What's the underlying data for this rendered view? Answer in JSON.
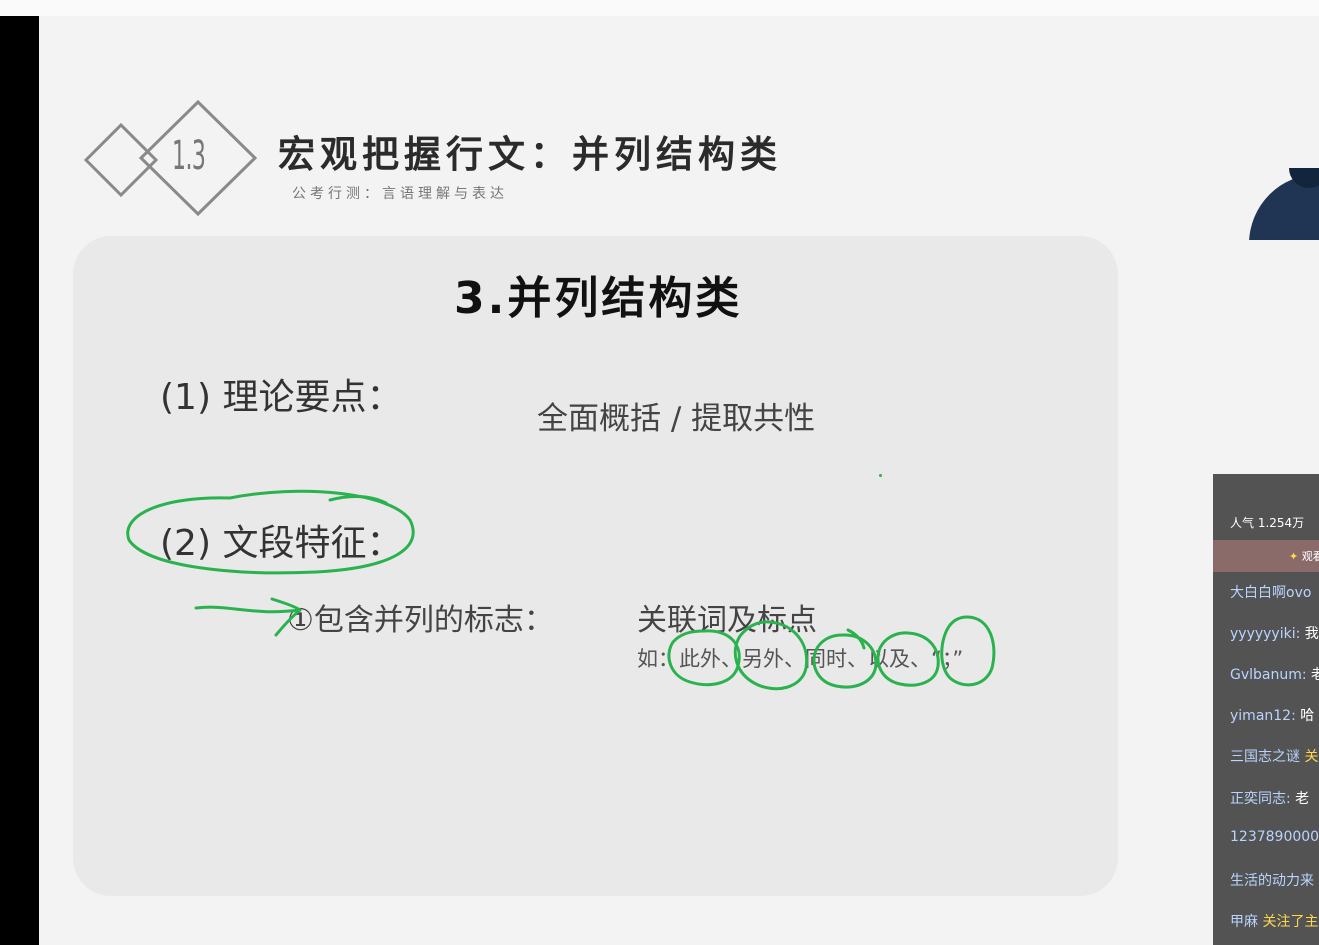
{
  "header": {
    "badge_number": "1.3",
    "title": "宏观把握行文：并列结构类",
    "subtitle": "公考行测：言语理解与表达"
  },
  "card": {
    "title": "3.并列结构类",
    "item1": {
      "label": "(1) 理论要点：",
      "value": "全面概括 / 提取共性"
    },
    "item2": {
      "label": "(2) 文段特征："
    },
    "sub1": {
      "label": "①包含并列的标志：",
      "value": "关联词及标点"
    },
    "examples": {
      "prefix": "如：",
      "items": [
        "此外",
        "另外",
        "同时",
        "以及",
        "“；”"
      ],
      "separator": "、"
    }
  },
  "chat": {
    "stats": "人气 1.254万",
    "banner": "观看",
    "messages": [
      {
        "user": "大白白啊ovo",
        "text": ""
      },
      {
        "user": "yyyyyyiki:",
        "text": "我"
      },
      {
        "user": "Gvlbanum:",
        "text": "老"
      },
      {
        "user": "yiman12:",
        "text": "哈"
      },
      {
        "user": "三国志之谜",
        "text": "关",
        "highlight": true
      },
      {
        "user": "正奕同志:",
        "text": "老"
      },
      {
        "user": "1237890000",
        "text": ""
      },
      {
        "user": "生活的动力来",
        "text": ""
      },
      {
        "user": "甲麻",
        "text": "关注了主",
        "highlight": true
      }
    ]
  },
  "colors": {
    "annotation": "#2ab24e",
    "card_bg": "#e9e9e9",
    "chat_bg": "#535353",
    "chat_highlight": "#ffd84d"
  }
}
